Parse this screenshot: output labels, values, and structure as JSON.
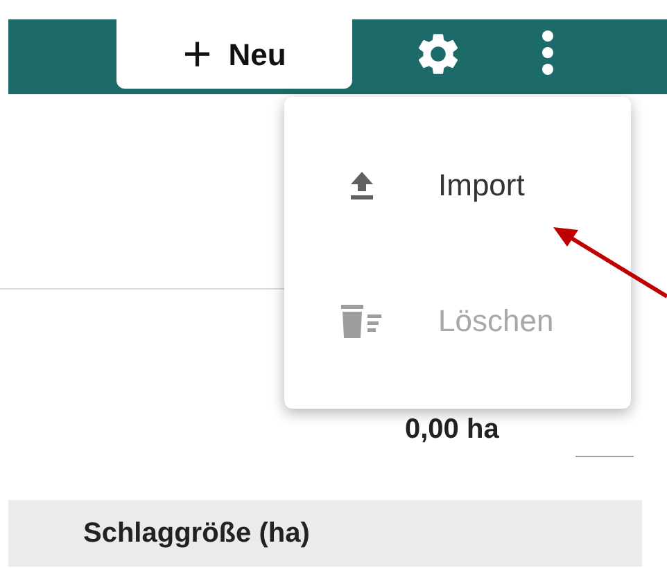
{
  "toolbar": {
    "new_button": {
      "icon": "+",
      "label": "Neu"
    }
  },
  "menu": {
    "items": [
      {
        "kind": "import",
        "label": "Import",
        "disabled": false
      },
      {
        "kind": "delete",
        "label": "Löschen",
        "disabled": true
      }
    ]
  },
  "summary": {
    "value": "0,00 ha"
  },
  "table": {
    "columns": [
      "Schlaggröße (ha)"
    ]
  }
}
